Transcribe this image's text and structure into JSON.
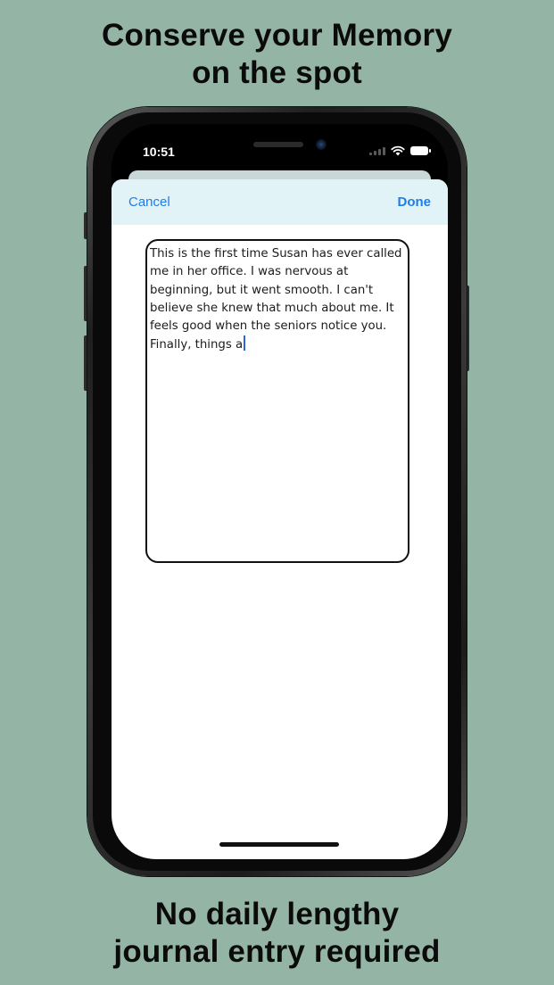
{
  "marketing": {
    "headline_top_line1": "Conserve your Memory",
    "headline_top_line2": "on the spot",
    "headline_bottom_line1": "No daily lengthy",
    "headline_bottom_line2": "journal entry required"
  },
  "status_bar": {
    "time": "10:51",
    "icons": [
      "cellular-signal-icon",
      "wifi-icon",
      "battery-icon"
    ]
  },
  "navbar": {
    "cancel_label": "Cancel",
    "done_label": "Done"
  },
  "editor": {
    "text": "This is the first time Susan has ever called me in her office. I was nervous at beginning, but it went smooth. I can't believe she knew that much about me. It feels good when the seniors notice you. Finally, things a"
  },
  "colors": {
    "background": "#94b5a6",
    "navbar_background": "#e2f3f7",
    "accent": "#1f7ee6",
    "caret": "#2f62d6"
  }
}
